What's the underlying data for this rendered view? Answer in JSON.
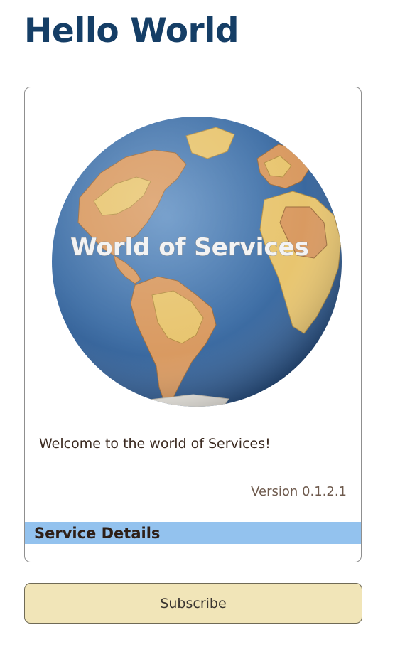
{
  "page": {
    "title": "Hello World"
  },
  "card": {
    "image_text": "World of Services",
    "welcome_text": "Welcome to the world of Services!",
    "version_text": "Version 0.1.2.1",
    "details_label": "Service Details"
  },
  "actions": {
    "subscribe_label": "Subscribe"
  },
  "colors": {
    "title": "#153e66",
    "details_bar": "#93c2ee",
    "subscribe_bg": "#f1e5b8",
    "ocean": "#3f6fa6",
    "land": "#e8c56f",
    "land_alt": "#d99a61"
  }
}
